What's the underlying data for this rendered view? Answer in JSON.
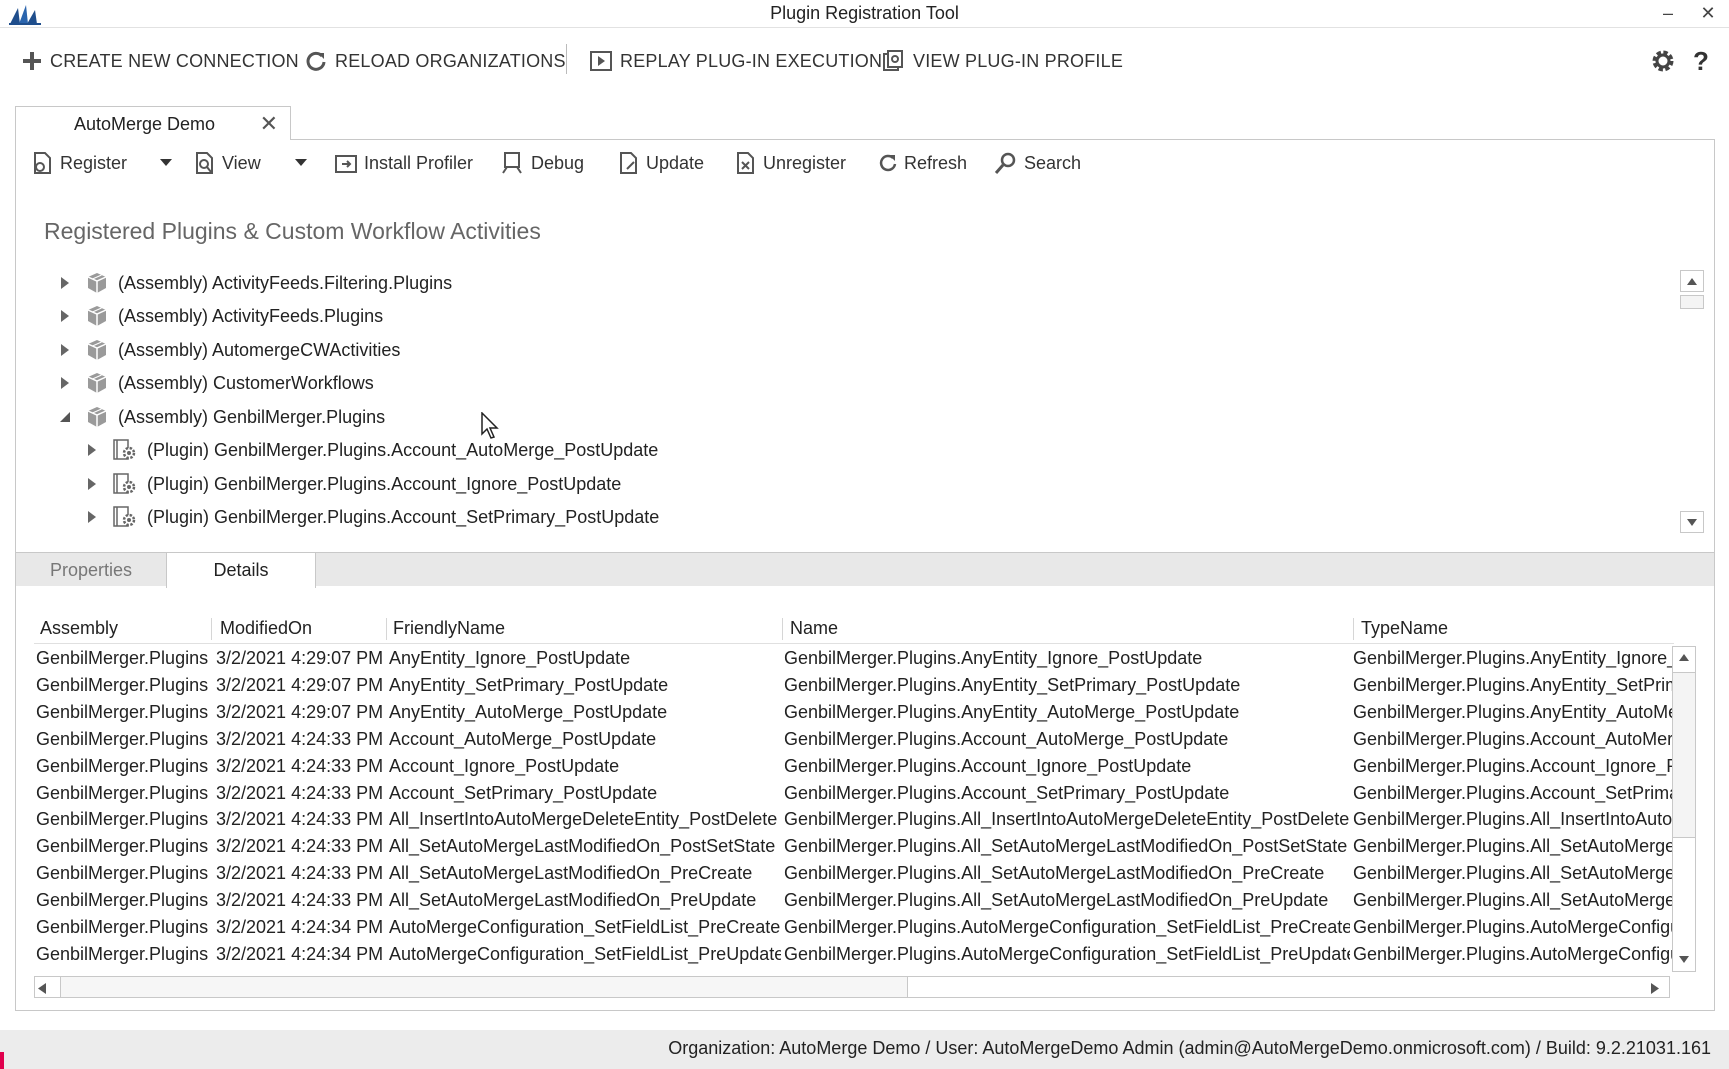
{
  "window": {
    "title": "Plugin Registration Tool",
    "minimize": "–",
    "close": "✕"
  },
  "main_toolbar": {
    "create_connection": "CREATE NEW CONNECTION",
    "reload_orgs": "RELOAD ORGANIZATIONS",
    "replay": "REPLAY PLUG-IN EXECUTION",
    "view_profile": "VIEW PLUG-IN PROFILE",
    "help": "?"
  },
  "doc_tab": {
    "label": "AutoMerge Demo",
    "close": "✕"
  },
  "toolbar": {
    "register": "Register",
    "view": "View",
    "install_profiler": "Install Profiler",
    "debug": "Debug",
    "update": "Update",
    "unregister": "Unregister",
    "refresh": "Refresh",
    "search": "Search"
  },
  "section_title": "Registered Plugins & Custom Workflow Activities",
  "tree": [
    {
      "label": "(Assembly) ActivityFeeds.Filtering.Plugins",
      "expanded": false,
      "level": 0,
      "kind": "assembly"
    },
    {
      "label": "(Assembly) ActivityFeeds.Plugins",
      "expanded": false,
      "level": 0,
      "kind": "assembly"
    },
    {
      "label": "(Assembly) AutomergeCWActivities",
      "expanded": false,
      "level": 0,
      "kind": "assembly"
    },
    {
      "label": "(Assembly) CustomerWorkflows",
      "expanded": false,
      "level": 0,
      "kind": "assembly"
    },
    {
      "label": "(Assembly) GenbilMerger.Plugins",
      "expanded": true,
      "level": 0,
      "kind": "assembly"
    },
    {
      "label": "(Plugin) GenbilMerger.Plugins.Account_AutoMerge_PostUpdate",
      "expanded": false,
      "level": 1,
      "kind": "plugin"
    },
    {
      "label": "(Plugin) GenbilMerger.Plugins.Account_Ignore_PostUpdate",
      "expanded": false,
      "level": 1,
      "kind": "plugin"
    },
    {
      "label": "(Plugin) GenbilMerger.Plugins.Account_SetPrimary_PostUpdate",
      "expanded": false,
      "level": 1,
      "kind": "plugin"
    }
  ],
  "bottom_tabs": {
    "properties": "Properties",
    "details": "Details",
    "active": "Details"
  },
  "grid": {
    "columns": [
      "Assembly",
      "ModifiedOn",
      "FriendlyName",
      "Name",
      "TypeName"
    ],
    "rows": [
      [
        "GenbilMerger.Plugins",
        "3/2/2021 4:29:07 PM",
        "AnyEntity_Ignore_PostUpdate",
        "GenbilMerger.Plugins.AnyEntity_Ignore_PostUpdate",
        "GenbilMerger.Plugins.AnyEntity_Ignore_PostUpdate"
      ],
      [
        "GenbilMerger.Plugins",
        "3/2/2021 4:29:07 PM",
        "AnyEntity_SetPrimary_PostUpdate",
        "GenbilMerger.Plugins.AnyEntity_SetPrimary_PostUpdate",
        "GenbilMerger.Plugins.AnyEntity_SetPrimary_PostUpdate"
      ],
      [
        "GenbilMerger.Plugins",
        "3/2/2021 4:29:07 PM",
        "AnyEntity_AutoMerge_PostUpdate",
        "GenbilMerger.Plugins.AnyEntity_AutoMerge_PostUpdate",
        "GenbilMerger.Plugins.AnyEntity_AutoMerge_PostUpdate"
      ],
      [
        "GenbilMerger.Plugins",
        "3/2/2021 4:24:33 PM",
        "Account_AutoMerge_PostUpdate",
        "GenbilMerger.Plugins.Account_AutoMerge_PostUpdate",
        "GenbilMerger.Plugins.Account_AutoMerge_PostUpdate"
      ],
      [
        "GenbilMerger.Plugins",
        "3/2/2021 4:24:33 PM",
        "Account_Ignore_PostUpdate",
        "GenbilMerger.Plugins.Account_Ignore_PostUpdate",
        "GenbilMerger.Plugins.Account_Ignore_PostUpdate"
      ],
      [
        "GenbilMerger.Plugins",
        "3/2/2021 4:24:33 PM",
        "Account_SetPrimary_PostUpdate",
        "GenbilMerger.Plugins.Account_SetPrimary_PostUpdate",
        "GenbilMerger.Plugins.Account_SetPrimary_PostUpdate"
      ],
      [
        "GenbilMerger.Plugins",
        "3/2/2021 4:24:33 PM",
        "All_InsertIntoAutoMergeDeleteEntity_PostDelete",
        "GenbilMerger.Plugins.All_InsertIntoAutoMergeDeleteEntity_PostDelete",
        "GenbilMerger.Plugins.All_InsertIntoAutoMergeDeleteEntity_PostDelete"
      ],
      [
        "GenbilMerger.Plugins",
        "3/2/2021 4:24:33 PM",
        "All_SetAutoMergeLastModifiedOn_PostSetState",
        "GenbilMerger.Plugins.All_SetAutoMergeLastModifiedOn_PostSetState",
        "GenbilMerger.Plugins.All_SetAutoMergeLastModifiedOn_PostSetState"
      ],
      [
        "GenbilMerger.Plugins",
        "3/2/2021 4:24:33 PM",
        "All_SetAutoMergeLastModifiedOn_PreCreate",
        "GenbilMerger.Plugins.All_SetAutoMergeLastModifiedOn_PreCreate",
        "GenbilMerger.Plugins.All_SetAutoMergeLastModifiedOn_PreCreate"
      ],
      [
        "GenbilMerger.Plugins",
        "3/2/2021 4:24:33 PM",
        "All_SetAutoMergeLastModifiedOn_PreUpdate",
        "GenbilMerger.Plugins.All_SetAutoMergeLastModifiedOn_PreUpdate",
        "GenbilMerger.Plugins.All_SetAutoMergeLastModifiedOn_PreUpdate"
      ],
      [
        "GenbilMerger.Plugins",
        "3/2/2021 4:24:34 PM",
        "AutoMergeConfiguration_SetFieldList_PreCreate",
        "GenbilMerger.Plugins.AutoMergeConfiguration_SetFieldList_PreCreate",
        "GenbilMerger.Plugins.AutoMergeConfiguration_SetFieldList_PreCreate"
      ],
      [
        "GenbilMerger.Plugins",
        "3/2/2021 4:24:34 PM",
        "AutoMergeConfiguration_SetFieldList_PreUpdate",
        "GenbilMerger.Plugins.AutoMergeConfiguration_SetFieldList_PreUpdate",
        "GenbilMerger.Plugins.AutoMergeConfiguration_SetFieldList_PreUpdate"
      ]
    ]
  },
  "status": "Organization: AutoMerge Demo / User: AutoMergeDemo Admin (admin@AutoMergeDemo.onmicrosoft.com) / Build: 9.2.21031.161",
  "colors": {
    "status_marker": "#e0004d",
    "logo": "#1f4e8c"
  }
}
